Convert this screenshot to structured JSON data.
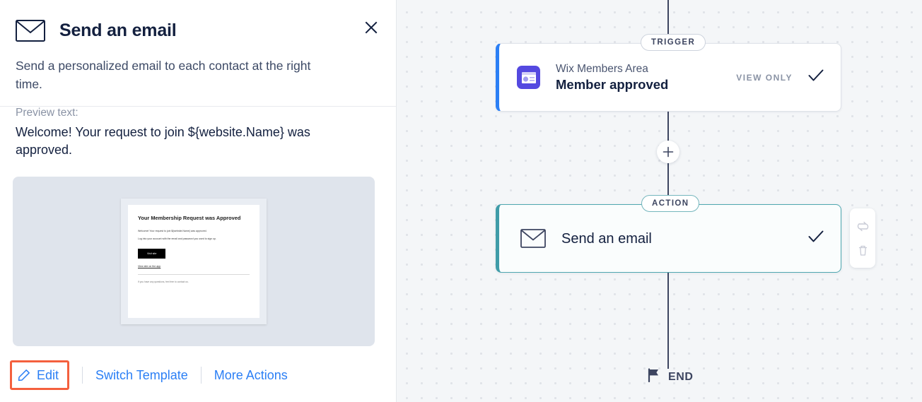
{
  "panel": {
    "icon": "envelope-icon",
    "title": "Send an email",
    "description": "Send a personalized email to each contact at the right time.",
    "close_icon": "close-icon",
    "preview_label": "Preview text:",
    "preview_text": "Welcome! Your request to join ${website.Name} was approved.",
    "email_preview": {
      "heading": "Your Membership Request was Approved",
      "paragraph1": "Welcome! Your request to join ${website.Name} was approved.",
      "paragraph2": "Log into your account with the email and password you used to sign up.",
      "button_label": "Visit site",
      "link_label": "View site on the app",
      "footer": "If you have any questions, feel free to contact us."
    },
    "actions": {
      "edit_label": "Edit",
      "edit_icon": "pencil-icon",
      "switch_template_label": "Switch Template",
      "more_actions_label": "More Actions",
      "highlight_color": "#f4603e",
      "link_color": "#2b7ff5"
    }
  },
  "canvas": {
    "trigger": {
      "pill_label": "TRIGGER",
      "app_name": "Wix Members Area",
      "event_name": "Member approved",
      "status_label": "VIEW ONLY",
      "check_icon": "check-icon",
      "app_icon": "wix-members-icon",
      "accent_color": "#2b7ff5"
    },
    "add_step": {
      "icon": "plus-icon"
    },
    "action": {
      "pill_label": "ACTION",
      "title": "Send an email",
      "icon": "envelope-icon",
      "check_icon": "check-icon",
      "accent_color": "#3f9ca8"
    },
    "side_toolbar": {
      "replace_icon": "swap-icon",
      "delete_icon": "trash-icon"
    },
    "end": {
      "icon": "flag-icon",
      "label": "END"
    },
    "cursor": "hand-pointer-cursor"
  }
}
